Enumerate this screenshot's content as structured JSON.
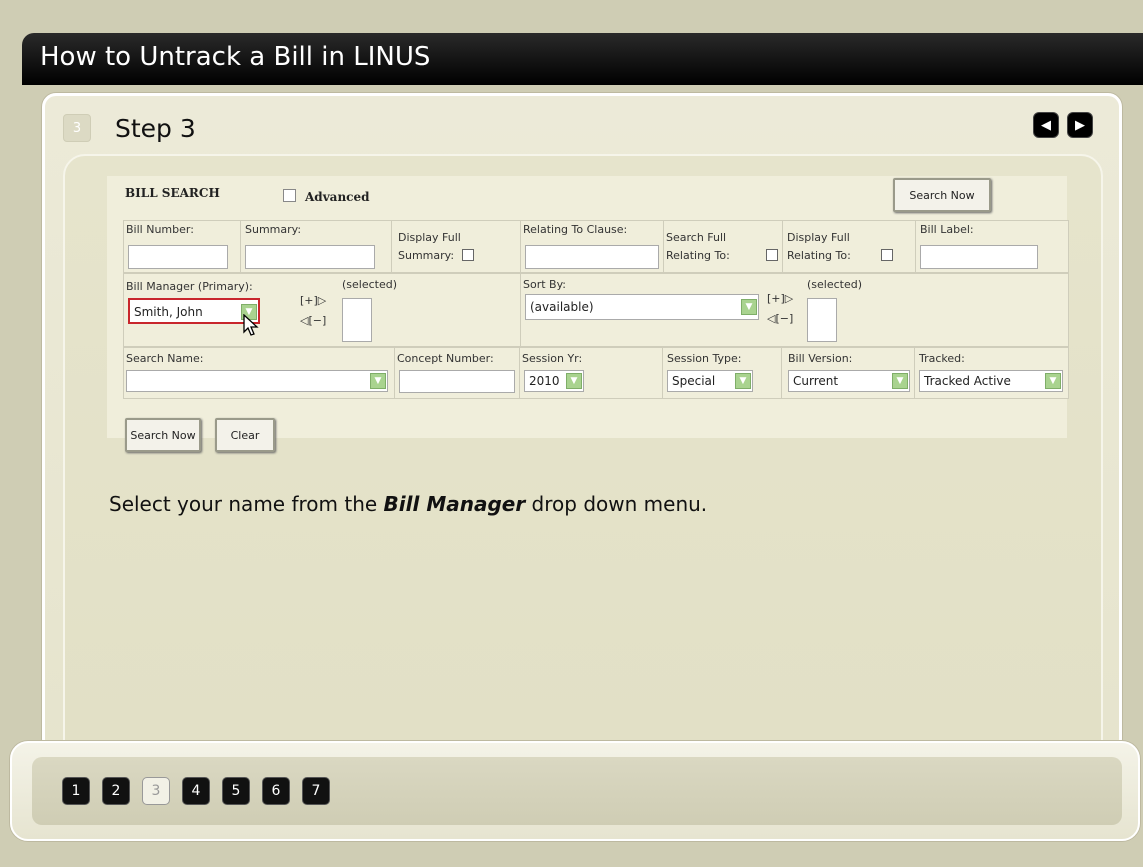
{
  "title": "How to Untrack a Bill in LINUS",
  "step": {
    "badge": "3",
    "title": "Step 3"
  },
  "nav": {
    "prev_icon": "◀",
    "next_icon": "▶"
  },
  "app": {
    "heading": "BILL SEARCH",
    "advanced_label": "Advanced",
    "search_now_top": "Search Now",
    "row1": {
      "bill_number": "Bill Number:",
      "summary": "Summary:",
      "display_full_summary_1": "Display Full",
      "display_full_summary_2": "Summary:",
      "relating_clause": "Relating To Clause:",
      "search_full_1": "Search Full",
      "search_full_2": "Relating To:",
      "display_full_rel_1": "Display Full",
      "display_full_rel_2": "Relating To:",
      "bill_label": "Bill Label:"
    },
    "row2": {
      "bill_manager": "Bill Manager (Primary):",
      "bill_manager_value": "Smith, John",
      "add": "[+]▷",
      "remove": "◁[−]",
      "selected": "(selected)",
      "sort_by": "Sort By:",
      "sort_value": "(available)",
      "add2": "[+]▷",
      "remove2": "◁[−]",
      "selected2": "(selected)"
    },
    "row3": {
      "search_name": "Search Name:",
      "concept_number": "Concept Number:",
      "session_yr": "Session Yr:",
      "session_yr_value": "2010",
      "session_type": "Session Type:",
      "session_type_value": "Special",
      "bill_version": "Bill Version:",
      "bill_version_value": "Current",
      "tracked": "Tracked:",
      "tracked_value": "Tracked Active"
    },
    "search_now_bottom": "Search Now",
    "clear": "Clear"
  },
  "instruction": {
    "pre": "Select your name from the ",
    "bold": "Bill Manager",
    "post": " drop down menu."
  },
  "pages": [
    "1",
    "2",
    "3",
    "4",
    "5",
    "6",
    "7"
  ],
  "active_page": "3",
  "colors": {
    "highlight": "#c8262c",
    "dropdown_arrow": "#a9d38f"
  }
}
